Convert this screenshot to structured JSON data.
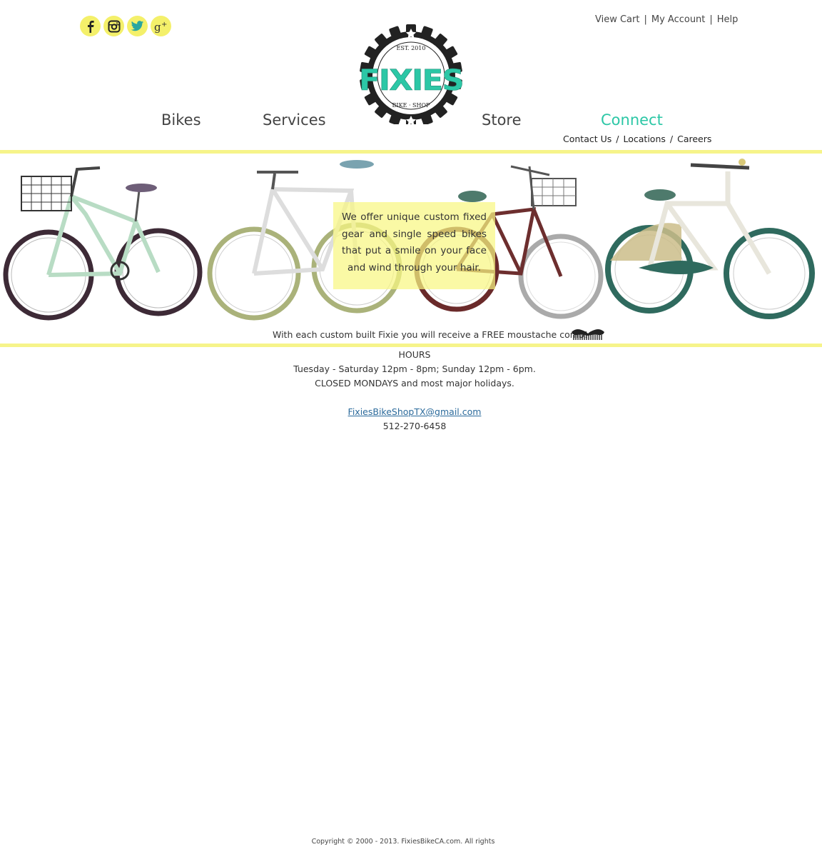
{
  "social": {
    "icons": [
      "facebook-icon",
      "instagram-icon",
      "twitter-icon",
      "google-plus-icon"
    ]
  },
  "top_links": {
    "view_cart": "View Cart",
    "sep1": "|",
    "my_account": "My Account",
    "sep2": "|",
    "help": "Help"
  },
  "logo": {
    "name": "FIXIES",
    "est": "EST. 2010",
    "sub": "BIKE · SHOP",
    "brand_color": "#2cc7a6"
  },
  "nav": {
    "bikes": "Bikes",
    "services": "Services",
    "store": "Store",
    "connect": "Connect",
    "active_color": "#2cc7a6"
  },
  "subnav": {
    "contact": "Contact Us",
    "slash1": "/",
    "locations": "Locations",
    "slash2": "/",
    "careers": "Careers"
  },
  "banner": {
    "promo": "We offer unique custom fixed gear and single speed bikes that put a smile on your face and wind through your hair.",
    "comb": "With each custom built Fixie you will receive a FREE moustache comb!",
    "accent_color": "#f6f48a"
  },
  "info": {
    "hours_title": "HOURS",
    "hours_line": "Tuesday - Saturday 12pm - 8pm;  Sunday 12pm - 6pm.",
    "closed_line": "CLOSED MONDAYS and most major holidays.",
    "email": "FixiesBikeShopTX@gmail.com",
    "phone": "512-270-6458"
  },
  "footer": {
    "copyright": "Copyright © 2000 - 2013. FixiesBikeCA.com. All rights"
  }
}
